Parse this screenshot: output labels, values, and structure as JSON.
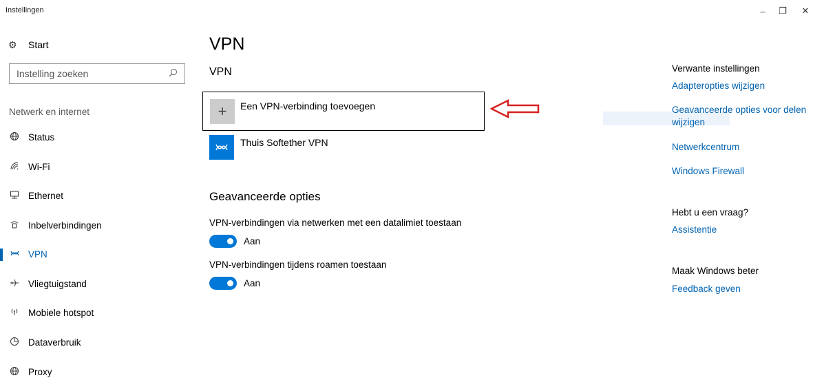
{
  "window": {
    "title": "Instellingen",
    "minimize_glyph": "–",
    "maximize_glyph": "❐",
    "close_glyph": "✕"
  },
  "sidebar": {
    "home_label": "Start",
    "search_placeholder": "Instelling zoeken",
    "section_label": "Netwerk en internet",
    "items": [
      {
        "label": "Status",
        "icon": "globe-icon"
      },
      {
        "label": "Wi-Fi",
        "icon": "wifi-icon"
      },
      {
        "label": "Ethernet",
        "icon": "ethernet-icon"
      },
      {
        "label": "Inbelverbindingen",
        "icon": "dialup-icon"
      },
      {
        "label": "VPN",
        "icon": "vpn-icon",
        "active": true
      },
      {
        "label": "Vliegtuigstand",
        "icon": "airplane-icon"
      },
      {
        "label": "Mobiele hotspot",
        "icon": "hotspot-icon"
      },
      {
        "label": "Dataverbruik",
        "icon": "data-usage-icon"
      },
      {
        "label": "Proxy",
        "icon": "proxy-globe-icon"
      }
    ]
  },
  "main": {
    "title": "VPN",
    "vpn_heading": "VPN",
    "add_connection_label": "Een VPN-verbinding toevoegen",
    "connections": [
      {
        "name": "Thuis Softether VPN"
      }
    ],
    "advanced_heading": "Geavanceerde opties",
    "options": [
      {
        "label": "VPN-verbindingen via netwerken met een datalimiet toestaan",
        "state": "Aan",
        "on": true
      },
      {
        "label": "VPN-verbindingen tijdens roamen toestaan",
        "state": "Aan",
        "on": true
      }
    ]
  },
  "related": {
    "heading": "Verwante instellingen",
    "links": [
      "Adapteropties wijzigen",
      "Geavanceerde opties voor delen wijzigen",
      "Netwerkcentrum",
      "Windows Firewall"
    ],
    "question_heading": "Hebt u een vraag?",
    "question_link": "Assistentie",
    "improve_heading": "Maak Windows beter",
    "improve_link": "Feedback geven"
  },
  "colors": {
    "accent": "#0078d7",
    "link": "#0063b1",
    "annotation_arrow": "#d62020"
  }
}
